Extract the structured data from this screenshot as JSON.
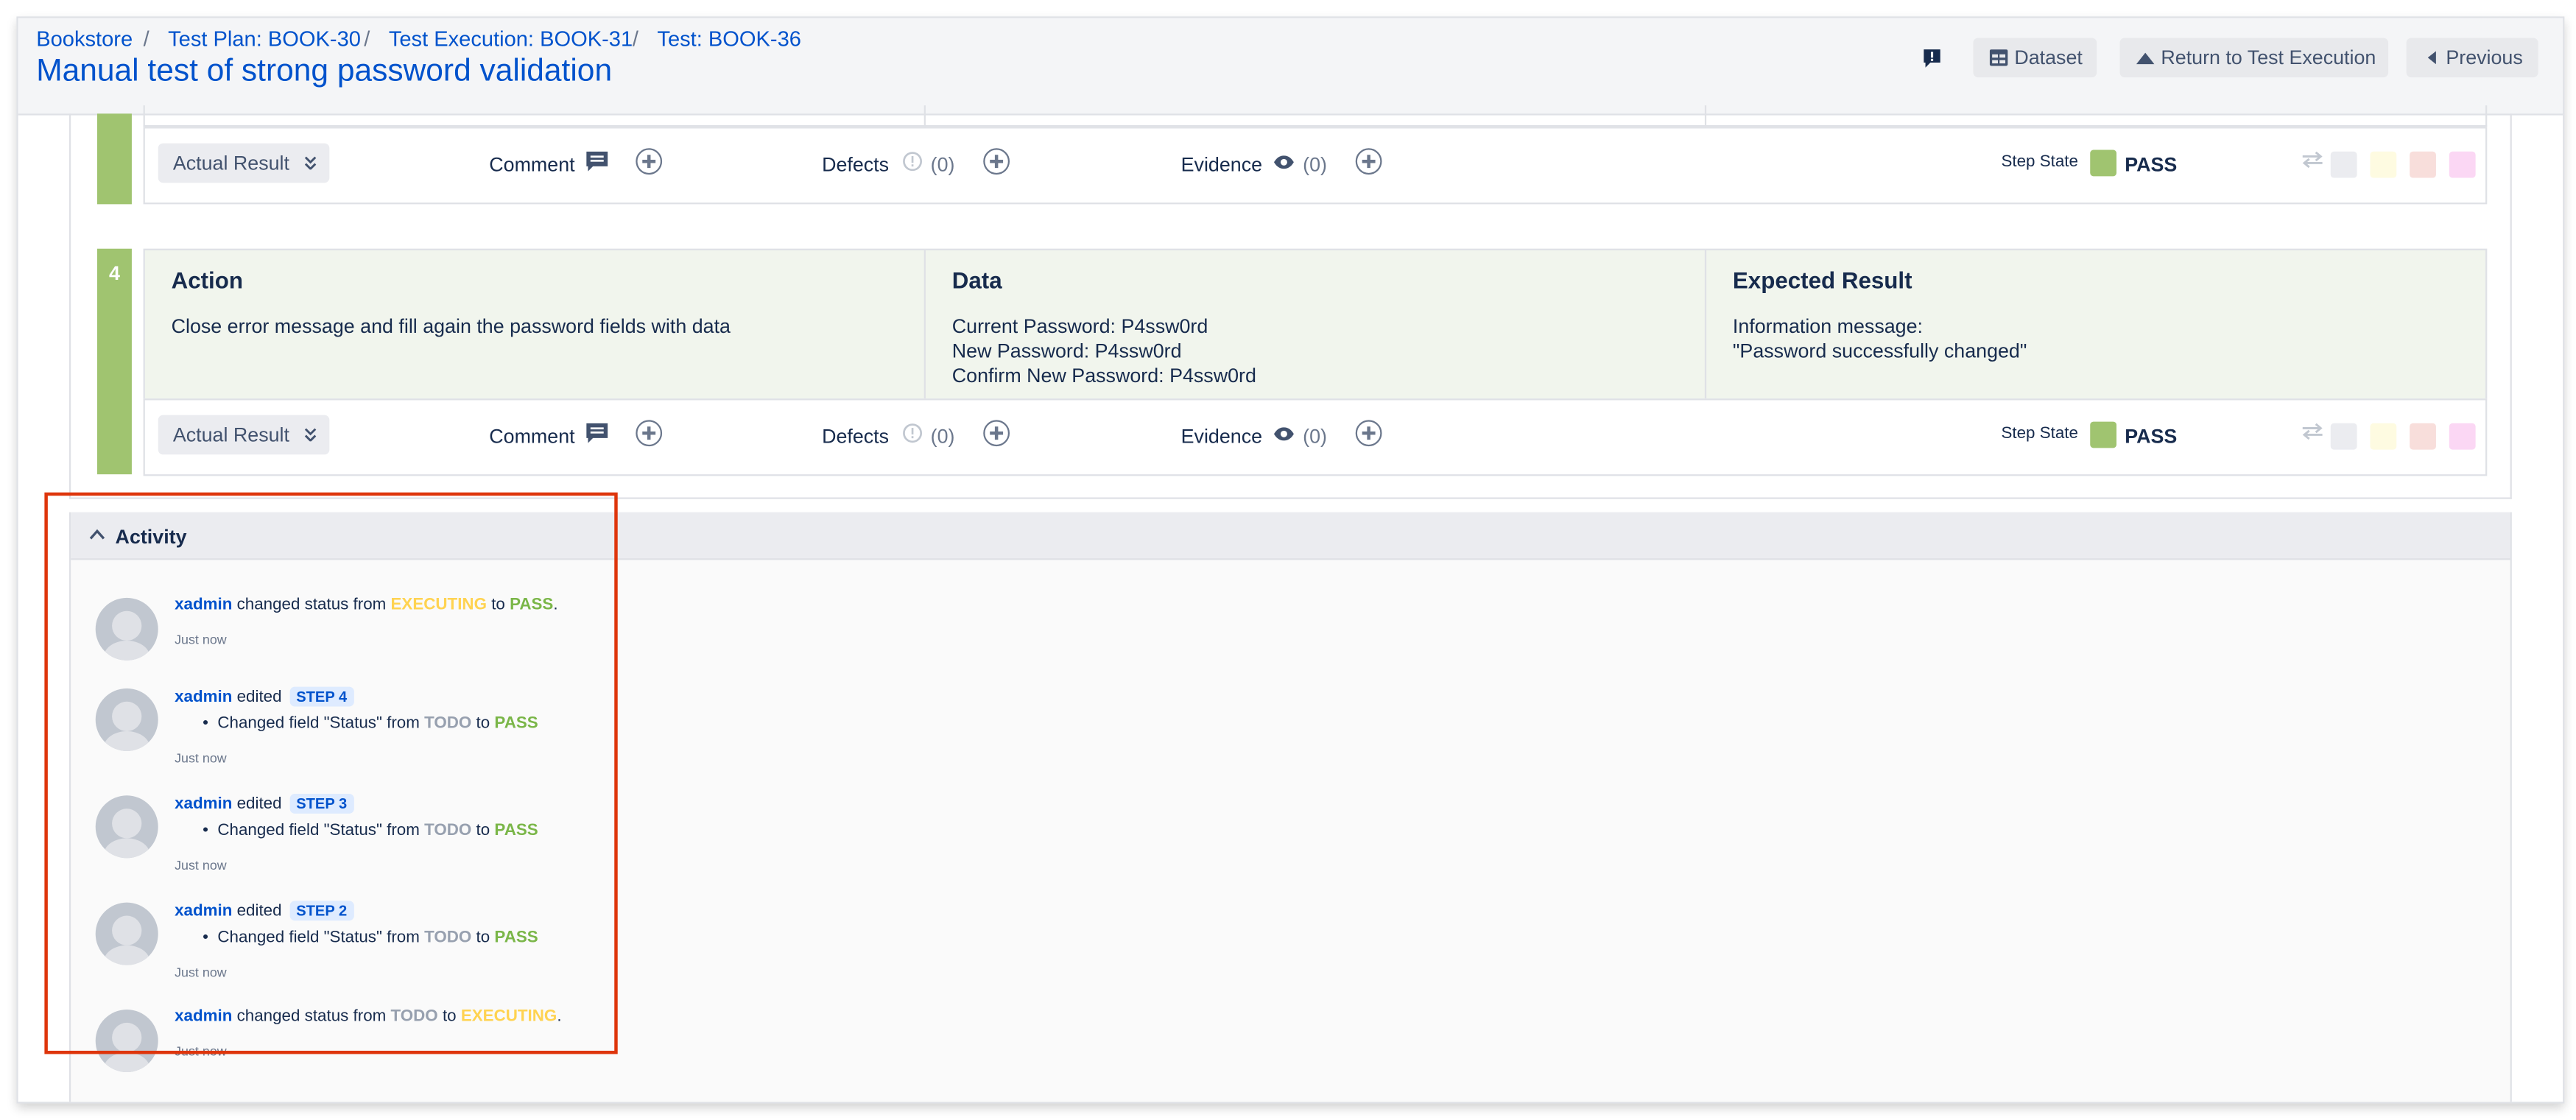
{
  "breadcrumbs": [
    "Bookstore",
    "Test Plan: BOOK-30",
    "Test Execution: BOOK-31",
    "Test: BOOK-36"
  ],
  "title": "Manual test of strong password validation",
  "header_buttons": {
    "dataset": "Dataset",
    "return": "Return to Test Execution",
    "previous": "Previous"
  },
  "step_bar": {
    "actual_result": "Actual Result",
    "comment": "Comment",
    "defects": "Defects",
    "evidence": "Evidence",
    "step_state_label": "Step State"
  },
  "step3": {
    "defects_count": "(0)",
    "evidence_count": "(0)",
    "state": "PASS"
  },
  "step4": {
    "number": "4",
    "action_header": "Action",
    "action": "Close error message and fill again the password fields with data",
    "data_header": "Data",
    "data_lines": [
      "Current Password: P4ssw0rd",
      "New Password: P4ssw0rd",
      "Confirm New Password: P4ssw0rd"
    ],
    "expected_header": "Expected Result",
    "expected_lines": [
      "Information message:",
      "\"Password successfully changed\""
    ],
    "defects_count": "(0)",
    "evidence_count": "(0)",
    "state": "PASS"
  },
  "activity": {
    "title": "Activity",
    "entries": [
      {
        "user": "xadmin",
        "verb": "changed status from",
        "from": "EXECUTING",
        "to_word": "to",
        "to": "PASS",
        "end": ".",
        "time": "Just now"
      },
      {
        "user": "xadmin",
        "verb": "edited",
        "badge": "STEP 4",
        "detail": "Changed field \"Status\" from",
        "from": "TODO",
        "to_word": "to",
        "to": "PASS",
        "time": "Just now"
      },
      {
        "user": "xadmin",
        "verb": "edited",
        "badge": "STEP 3",
        "detail": "Changed field \"Status\" from",
        "from": "TODO",
        "to_word": "to",
        "to": "PASS",
        "time": "Just now"
      },
      {
        "user": "xadmin",
        "verb": "edited",
        "badge": "STEP 2",
        "detail": "Changed field \"Status\" from",
        "from": "TODO",
        "to_word": "to",
        "to": "PASS",
        "time": "Just now"
      },
      {
        "user": "xadmin",
        "verb": "changed status from",
        "from": "TODO",
        "to_word": "to",
        "to": "EXECUTING",
        "end": ".",
        "time": "Just now"
      }
    ]
  },
  "colors": {
    "pass": "#a0c470",
    "link": "#0052CC",
    "executing": "#ffd351",
    "highlight": "#DE350B"
  }
}
